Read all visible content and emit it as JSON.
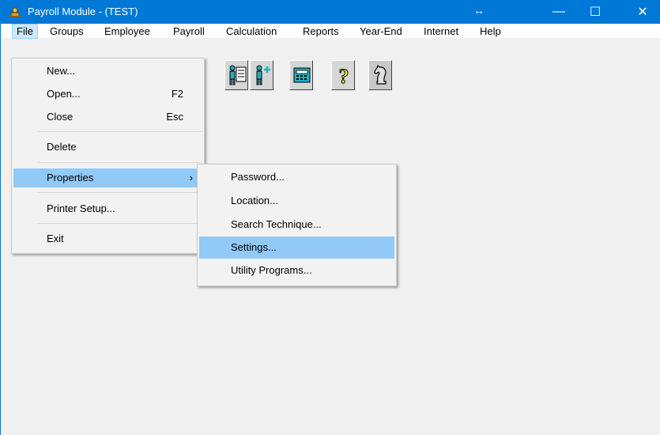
{
  "window": {
    "title": "Payroll Module - (TEST)",
    "title_icon": "payroll-app-icon",
    "resize_glyph": "↔",
    "controls": {
      "minimize": "—",
      "maximize": "☐",
      "close": "✕"
    },
    "accent_color": "#0078d7"
  },
  "menubar": {
    "items": [
      {
        "label": "File"
      },
      {
        "label": "Groups"
      },
      {
        "label": "Employee"
      },
      {
        "label": "Payroll"
      },
      {
        "label": "Calculation"
      },
      {
        "label": "Reports"
      },
      {
        "label": "Year-End"
      },
      {
        "label": "Internet"
      },
      {
        "label": "Help"
      }
    ],
    "active": "File"
  },
  "toolbar": {
    "buttons": [
      {
        "icon": "checkmark-icon"
      },
      {
        "icon": "employee-record-icon"
      },
      {
        "icon": "add-employee-icon"
      },
      {
        "icon": "calculator-icon"
      },
      {
        "icon": "help-question-icon"
      },
      {
        "icon": "chess-knight-icon"
      }
    ]
  },
  "file_menu": {
    "items": [
      {
        "label": "New...",
        "shortcut": ""
      },
      {
        "label": "Open...",
        "shortcut": "F2"
      },
      {
        "label": "Close",
        "shortcut": "Esc"
      },
      {
        "label": "Delete",
        "shortcut": ""
      },
      {
        "label": "Properties",
        "shortcut": "",
        "arrow": "›"
      },
      {
        "label": "Printer Setup...",
        "shortcut": ""
      },
      {
        "label": "Exit",
        "shortcut": ""
      }
    ],
    "highlighted": "Properties"
  },
  "properties_submenu": {
    "items": [
      {
        "label": "Password..."
      },
      {
        "label": "Location..."
      },
      {
        "label": "Search Technique..."
      },
      {
        "label": "Settings..."
      },
      {
        "label": "Utility Programs..."
      }
    ],
    "highlighted": "Settings...",
    "highlight_color": "#91c9f7"
  }
}
